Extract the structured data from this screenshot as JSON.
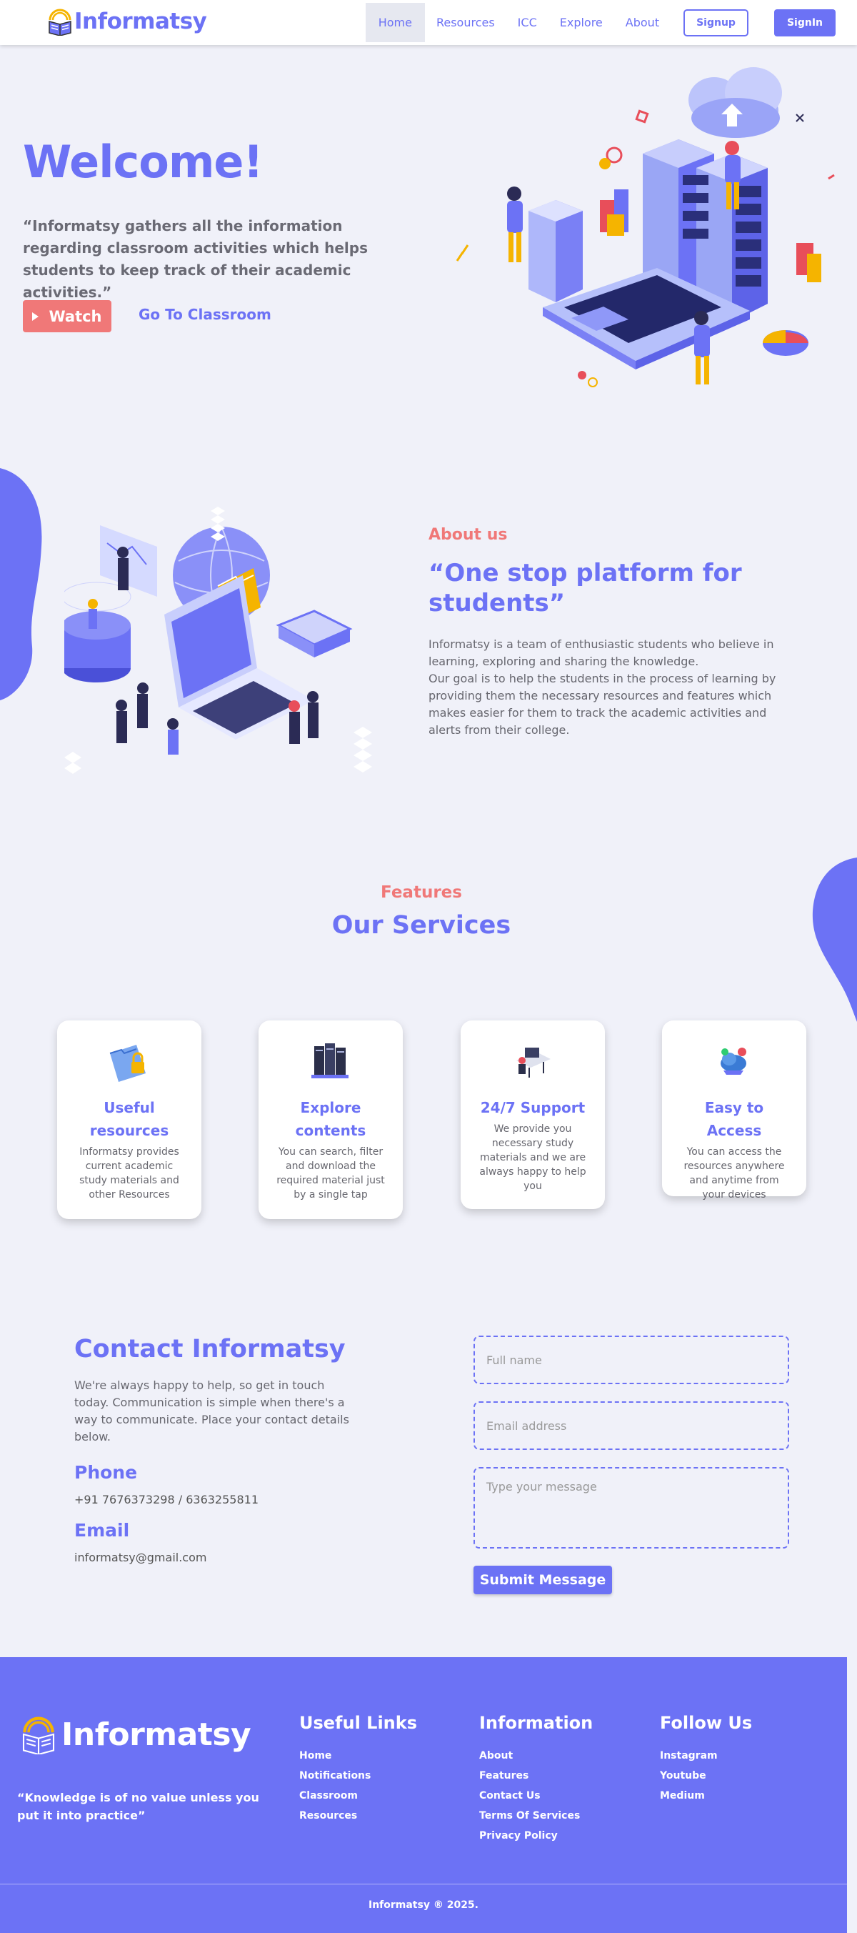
{
  "brand": {
    "name": "Informatsy",
    "primary": "#6c72f5",
    "accent": "#f07878"
  },
  "nav": {
    "links": [
      "Home",
      "Resources",
      "ICC",
      "Explore",
      "About"
    ],
    "active": "Home",
    "signup": "Signup",
    "signin": "SignIn"
  },
  "hero": {
    "title": "Welcome!",
    "text": "“Informatsy gathers all the information regarding classroom activities which helps students to keep track of their academic activities.”",
    "watch": "Watch",
    "classroom": "Go To Classroom"
  },
  "about": {
    "kicker": "About us",
    "title": "“One stop platform for students”",
    "p1": "Informatsy is a team of enthusiastic students who believe in learning, exploring and sharing the knowledge.",
    "p2": "Our goal is to help the students in the process of learning by providing them the necessary resources and features which makes easier for them to track the academic activities and alerts from their college."
  },
  "services": {
    "kicker": "Features",
    "title": "Our Services",
    "cards": [
      {
        "icon": "folder-lock-icon",
        "title": "Useful resources",
        "text": "Informatsy provides current academic study materials and other Resources"
      },
      {
        "icon": "books-icon",
        "title": "Explore contents",
        "text": "You can search, filter and download the required material just by a single tap"
      },
      {
        "icon": "support-desk-icon",
        "title": "24/7 Support",
        "text": "We provide you necessary study materials and we are always happy to help you"
      },
      {
        "icon": "cloud-access-icon",
        "title": "Easy to Access",
        "text": "You can access the resources anywhere and anytime from your devices"
      }
    ]
  },
  "contact": {
    "title": "Contact Informatsy",
    "text": "We're always happy to help, so get in touch today. Communication is simple when there's a way to communicate. Place your contact details below.",
    "phone_label": "Phone",
    "phone": "+91 7676373298 / 6363255811",
    "email_label": "Email",
    "email": "informatsy@gmail.com",
    "form": {
      "name_placeholder": "Full name",
      "email_placeholder": "Email address",
      "message_placeholder": "Type your message",
      "submit": "Submit Message"
    }
  },
  "footer": {
    "brand": "Informatsy",
    "quote": "“Knowledge is of no value unless you put it into practice”",
    "useful": {
      "title": "Useful Links",
      "links": [
        "Home",
        "Notifications",
        "Classroom",
        "Resources"
      ]
    },
    "info": {
      "title": "Information",
      "links": [
        "About",
        "Features",
        "Contact Us",
        "Terms Of Services",
        "Privacy Policy"
      ]
    },
    "follow": {
      "title": "Follow Us",
      "links": [
        "Instagram",
        "Youtube",
        "Medium"
      ]
    },
    "copyright": "Informatsy ® 2025."
  }
}
